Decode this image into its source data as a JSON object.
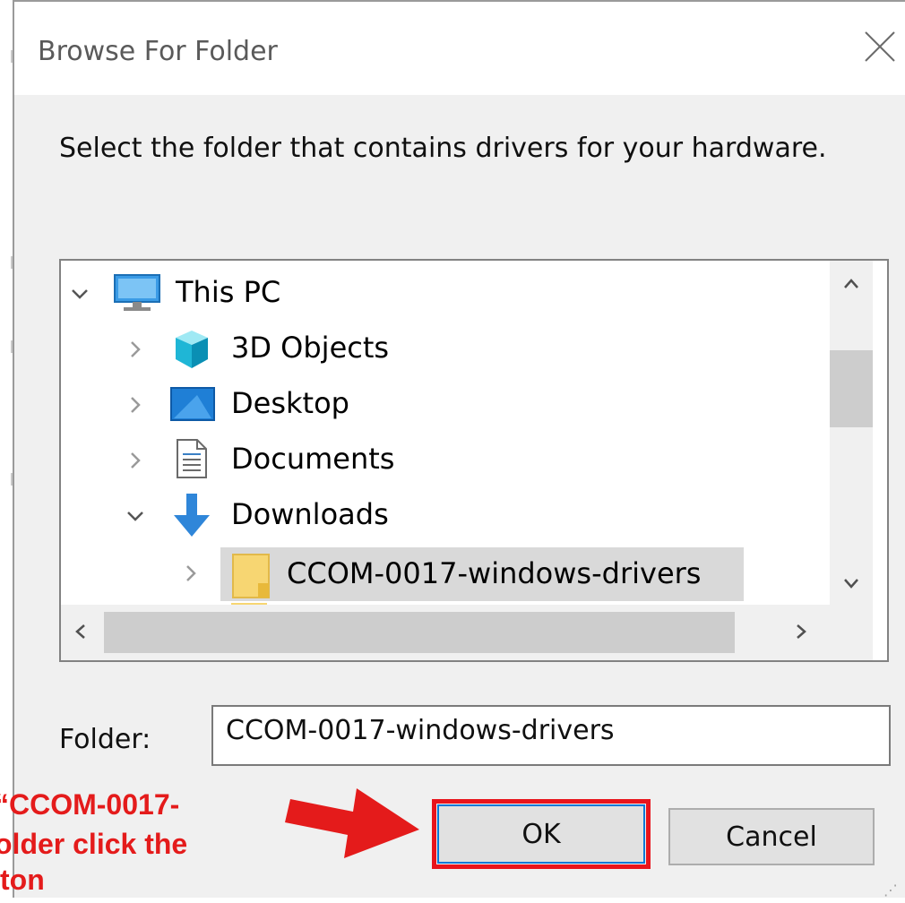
{
  "dialog": {
    "title": "Browse For Folder",
    "instruction": "Select the folder that contains drivers for your hardware.",
    "close_icon": "close-icon"
  },
  "tree": {
    "items": [
      {
        "label": "This PC",
        "icon": "monitor-icon",
        "expanded": true,
        "level": 0
      },
      {
        "label": "3D Objects",
        "icon": "cube-icon",
        "expanded": false,
        "level": 1
      },
      {
        "label": "Desktop",
        "icon": "desktop-icon",
        "expanded": false,
        "level": 1
      },
      {
        "label": "Documents",
        "icon": "document-icon",
        "expanded": false,
        "level": 1
      },
      {
        "label": "Downloads",
        "icon": "download-arrow-icon",
        "expanded": true,
        "level": 1
      },
      {
        "label": "CCOM-0017-windows-drivers",
        "icon": "folder-icon",
        "expanded": false,
        "level": 2,
        "selected": true
      }
    ]
  },
  "folder_field": {
    "label": "Folder:",
    "value": "CCOM-0017-windows-drivers"
  },
  "buttons": {
    "ok": "OK",
    "cancel": "Cancel"
  },
  "annotation": {
    "line1": "“CCOM-0017-",
    "line2": "older click the",
    "line3": "ton",
    "color": "#e41b1b"
  },
  "colors": {
    "selection": "#d9d9d9",
    "ok_highlight": "#e8141c",
    "accent": "#0078d7"
  }
}
